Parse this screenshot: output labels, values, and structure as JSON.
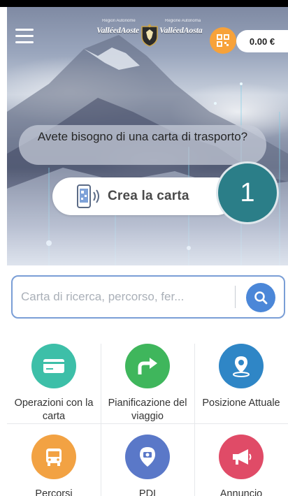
{
  "header": {
    "menu_icon": "hamburger-menu-icon",
    "logo_left": "ValléedAoste",
    "logo_left_sub": "Région Autonome",
    "logo_right": "ValléedAosta",
    "logo_right_sub": "Regione Autonoma",
    "crest_icon": "region-crest-icon",
    "qr_icon": "qr-code-icon",
    "balance": "0.00 €",
    "colors": {
      "qr_button": "#f7a23a"
    }
  },
  "hero": {
    "question": "Avete bisogno di una carta di trasporto?",
    "create_card_label": "Crea la carta",
    "create_card_icon": "phone-nfc-icon",
    "step_badge": "1",
    "colors": {
      "step_badge": "#2b7e88"
    }
  },
  "search": {
    "placeholder": "Carta di ricerca, percorso, fer...",
    "icon": "search-icon",
    "colors": {
      "border": "#7a9ed6",
      "button": "#4b87d8"
    }
  },
  "grid": {
    "items": [
      {
        "label": "Operazioni con la carta",
        "icon": "card-icon",
        "color": "#3dbfa8"
      },
      {
        "label": "Pianificazione del viaggio",
        "icon": "turn-right-arrow-icon",
        "color": "#3fb65c"
      },
      {
        "label": "Posizione Attuale",
        "icon": "location-pin-icon",
        "color": "#2f86c6"
      },
      {
        "label": "Percorsi",
        "icon": "bus-icon",
        "color": "#f2a243"
      },
      {
        "label": "PDI",
        "icon": "poi-pin-icon",
        "color": "#5a78c8"
      },
      {
        "label": "Annuncio",
        "icon": "megaphone-icon",
        "color": "#e04b67"
      }
    ]
  }
}
